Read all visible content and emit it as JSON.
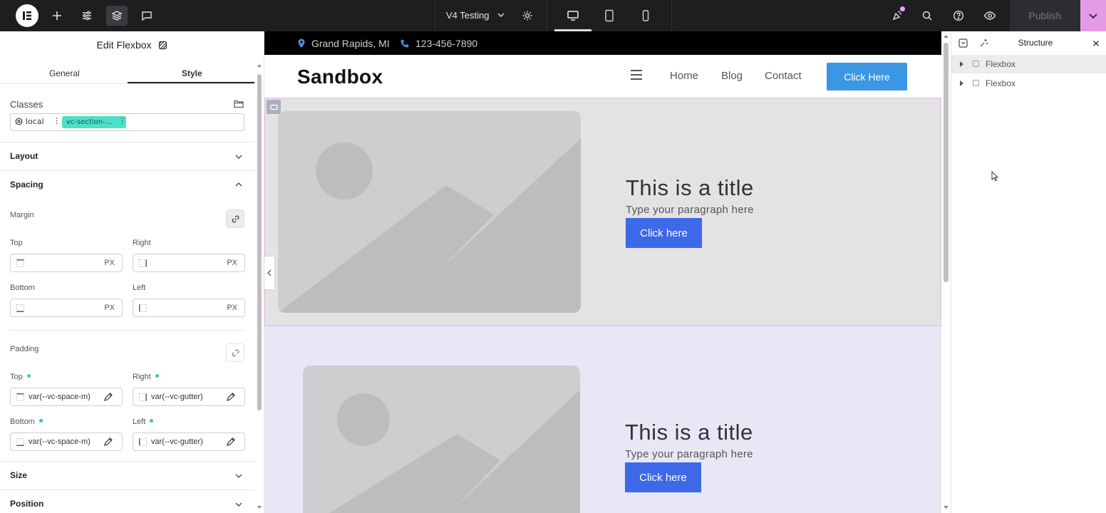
{
  "topbar": {
    "site_name": "V4 Testing",
    "publish_label": "Publish"
  },
  "panel": {
    "title": "Edit Flexbox",
    "tabs": [
      {
        "label": "General"
      },
      {
        "label": "Style"
      }
    ],
    "classes_label": "Classes",
    "class_chips": [
      {
        "label": "local"
      },
      {
        "label": "vc-section-..."
      }
    ],
    "sections": {
      "layout": "Layout",
      "spacing": "Spacing",
      "size": "Size",
      "position": "Position"
    },
    "margin": {
      "label": "Margin",
      "top_label": "Top",
      "right_label": "Right",
      "bottom_label": "Bottom",
      "left_label": "Left",
      "unit": "PX"
    },
    "padding": {
      "label": "Padding",
      "top_label": "Top",
      "right_label": "Right",
      "bottom_label": "Bottom",
      "left_label": "Left",
      "top_value": "var(--vc-space-m)",
      "right_value": "var(--vc-gutter)",
      "bottom_value": "var(--vc-space-m)",
      "left_value": "var(--vc-gutter)"
    }
  },
  "site": {
    "location": "Grand Rapids, MI",
    "phone": "123-456-7890",
    "brand": "Sandbox",
    "nav": [
      {
        "label": "Home"
      },
      {
        "label": "Blog"
      },
      {
        "label": "Contact"
      }
    ],
    "nav_button": "Click Here",
    "sections": [
      {
        "title": "This is a title",
        "paragraph": "Type your paragraph here",
        "button": "Click here"
      },
      {
        "title": "This is a title",
        "paragraph": "Type your paragraph here",
        "button": "Click here"
      }
    ]
  },
  "structure": {
    "title": "Structure",
    "items": [
      {
        "label": "Flexbox"
      },
      {
        "label": "Flexbox"
      }
    ]
  },
  "colors": {
    "accent_publish_more": "#e59ae8",
    "nav_button": "#3b97e3",
    "hero_button": "#3d68e8",
    "class_chip": "#4ee0c6"
  }
}
